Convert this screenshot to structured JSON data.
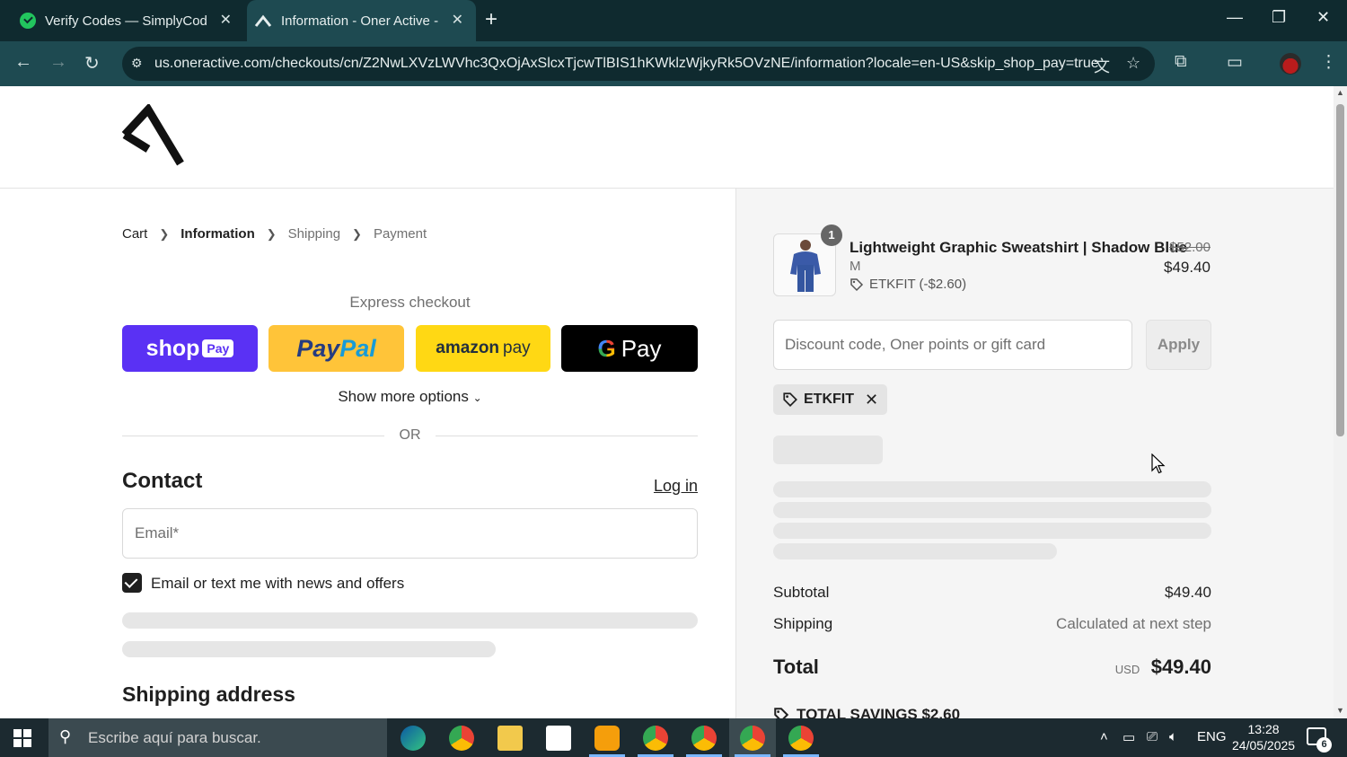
{
  "browser": {
    "tabs": [
      {
        "title": "Verify Codes — SimplyCodes"
      },
      {
        "title": "Information - Oner Active - US"
      }
    ],
    "url": "us.oneractive.com/checkouts/cn/Z2NwLXVzLWVhc3QxOjAxSlcxTjcwTlBIS1hKWklzWjkyRk5OVzNE/information?locale=en-US&skip_shop_pay=true"
  },
  "breadcrumb": {
    "cart": "Cart",
    "information": "Information",
    "shipping": "Shipping",
    "payment": "Payment"
  },
  "express": {
    "label": "Express checkout",
    "shop_pay": "shop",
    "shop_pay_badge": "Pay",
    "paypal_1": "Pay",
    "paypal_2": "Pal",
    "amazon": "amazon",
    "amazon_pay": "pay",
    "gpay_g": "G",
    "gpay": "Pay",
    "more_options": "Show more options",
    "or": "OR"
  },
  "contact": {
    "heading": "Contact",
    "login": "Log in",
    "email_placeholder": "Email*",
    "news_label": "Email or text me with news and offers",
    "news_checked": true
  },
  "shipping_address": {
    "heading": "Shipping address"
  },
  "order": {
    "item": {
      "quantity": "1",
      "name": "Lightweight Graphic Sweatshirt | Shadow Blue",
      "variant": "M",
      "discount": "ETKFIT (-$2.60)",
      "price_original": "$52.00",
      "price_final": "$49.40"
    },
    "discount_placeholder": "Discount code, Oner points or gift card",
    "apply": "Apply",
    "applied_code": "ETKFIT",
    "subtotal_label": "Subtotal",
    "subtotal_value": "$49.40",
    "shipping_label": "Shipping",
    "shipping_value": "Calculated at next step",
    "total_label": "Total",
    "currency": "USD",
    "total_value": "$49.40",
    "savings": "TOTAL SAVINGS $2.60"
  },
  "taskbar": {
    "search_placeholder": "Escribe aquí para buscar.",
    "language": "ENG",
    "time": "13:28",
    "date": "24/05/2025",
    "notifications": "6"
  },
  "colors": {
    "shop_pay": "#5a31f4",
    "paypal": "#ffc439",
    "amazon": "#ffd814",
    "gpay": "#000000",
    "chrome_bg": "#0f2a2f"
  }
}
